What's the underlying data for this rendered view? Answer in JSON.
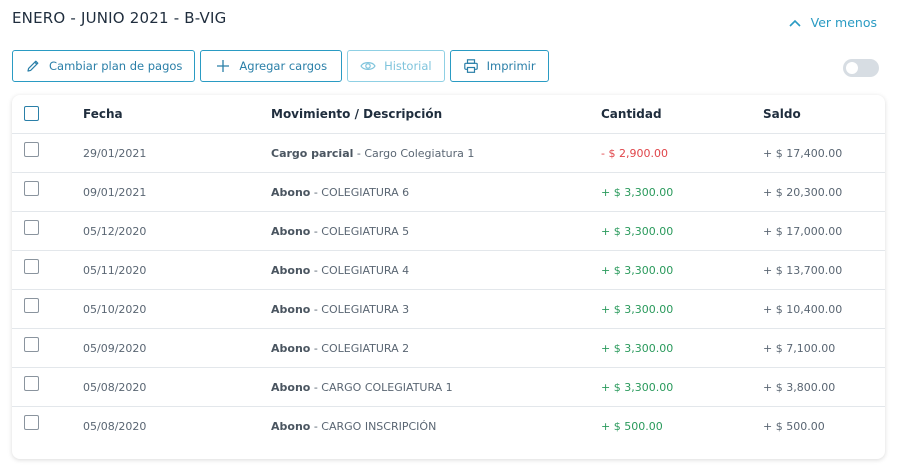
{
  "header": {
    "title": "ENERO - JUNIO 2021 - B-VIG",
    "toggle_label": "Ver menos"
  },
  "toolbar": {
    "change_plan_label": "Cambiar plan de pagos",
    "add_charges_label": "Agregar cargos",
    "history_label": "Historial",
    "print_label": "Imprimir"
  },
  "table": {
    "columns": {
      "fecha": "Fecha",
      "movimiento": "Movimiento / Descripción",
      "cantidad": "Cantidad",
      "saldo": "Saldo"
    },
    "rows": [
      {
        "fecha": "29/01/2021",
        "tipo": "Cargo parcial",
        "desc": " - Cargo Colegiatura 1",
        "cantidad": "- $ 2,900.00",
        "signo": "neg",
        "saldo": "+ $ 17,400.00"
      },
      {
        "fecha": "09/01/2021",
        "tipo": "Abono",
        "desc": " - COLEGIATURA 6",
        "cantidad": "+ $ 3,300.00",
        "signo": "pos",
        "saldo": "+ $ 20,300.00"
      },
      {
        "fecha": "05/12/2020",
        "tipo": "Abono",
        "desc": " - COLEGIATURA 5",
        "cantidad": "+ $ 3,300.00",
        "signo": "pos",
        "saldo": "+ $ 17,000.00"
      },
      {
        "fecha": "05/11/2020",
        "tipo": "Abono",
        "desc": " - COLEGIATURA 4",
        "cantidad": "+ $ 3,300.00",
        "signo": "pos",
        "saldo": "+ $ 13,700.00"
      },
      {
        "fecha": "05/10/2020",
        "tipo": "Abono",
        "desc": " - COLEGIATURA 3",
        "cantidad": "+ $ 3,300.00",
        "signo": "pos",
        "saldo": "+ $ 10,400.00"
      },
      {
        "fecha": "05/09/2020",
        "tipo": "Abono",
        "desc": " - COLEGIATURA 2",
        "cantidad": "+ $ 3,300.00",
        "signo": "pos",
        "saldo": "+ $ 7,100.00"
      },
      {
        "fecha": "05/08/2020",
        "tipo": "Abono",
        "desc": " - CARGO COLEGIATURA 1",
        "cantidad": "+ $ 3,300.00",
        "signo": "pos",
        "saldo": "+ $ 3,800.00"
      },
      {
        "fecha": "05/08/2020",
        "tipo": "Abono",
        "desc": " - CARGO INSCRIPCIÓN",
        "cantidad": "+ $ 500.00",
        "signo": "pos",
        "saldo": "+ $ 500.00"
      }
    ]
  },
  "colors": {
    "accent": "#2a9bc3",
    "negative": "#e0454a",
    "positive": "#2a9a5c"
  }
}
